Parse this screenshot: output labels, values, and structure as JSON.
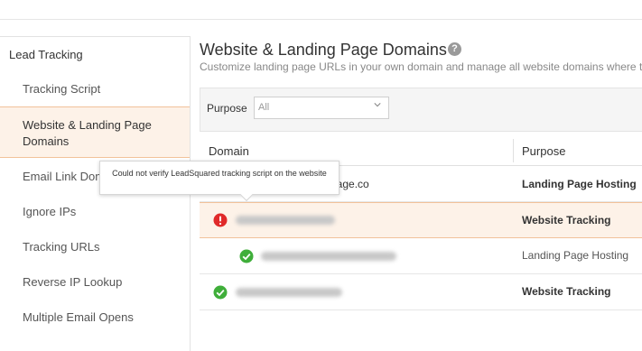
{
  "sidebar": {
    "section_title": "Lead Tracking",
    "items": [
      {
        "label": "Tracking Script"
      },
      {
        "label": "Website & Landing Page Domains"
      },
      {
        "label": "Email Link Domains"
      },
      {
        "label": "Ignore IPs"
      },
      {
        "label": "Tracking URLs"
      },
      {
        "label": "Reverse IP Lookup"
      },
      {
        "label": "Multiple Email Opens"
      }
    ]
  },
  "main": {
    "title": "Website & Landing Page Domains",
    "help_icon": "?",
    "subtitle": "Customize landing page URLs in your own domain and manage all website domains where tr",
    "filter": {
      "label": "Purpose",
      "value": "All"
    },
    "table": {
      "headers": [
        "Domain",
        "Purpose"
      ],
      "rows": [
        {
          "domain_suffix": "page.co",
          "purpose": "Landing Page Hosting",
          "status": "none"
        },
        {
          "domain_suffix": "",
          "purpose": "Website Tracking",
          "status": "error"
        },
        {
          "domain_suffix": "",
          "purpose": "Landing Page Hosting",
          "status": "ok"
        },
        {
          "domain_suffix": "",
          "purpose": "Website Tracking",
          "status": "ok"
        }
      ]
    },
    "tooltip": "Could not verify LeadSquared tracking script on the website"
  },
  "colors": {
    "error": "#e02a2a",
    "ok": "#3fae3a",
    "highlight": "#fdf2e8",
    "highlight_border": "#f2c29a"
  }
}
